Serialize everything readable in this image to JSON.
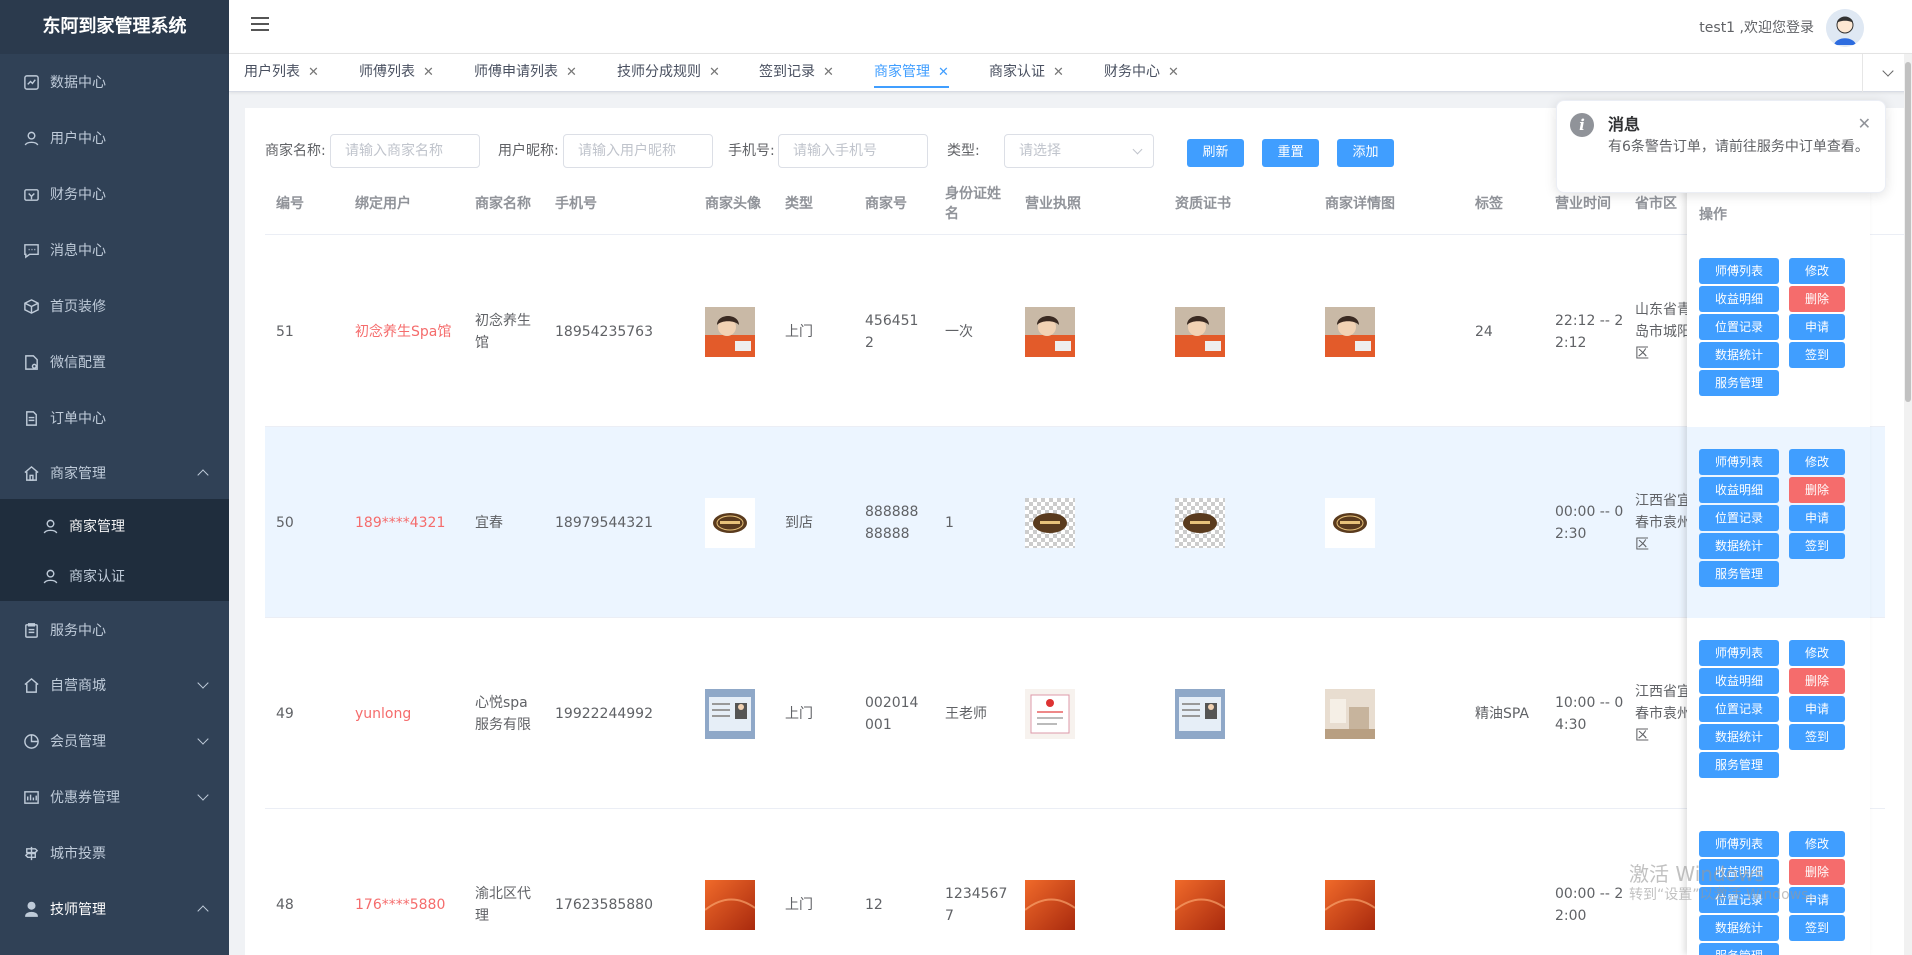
{
  "app_title": "东阿到家管理系统",
  "sidebar": {
    "items": [
      {
        "label": "数据中心",
        "icon": "chart-icon"
      },
      {
        "label": "用户中心",
        "icon": "user-icon"
      },
      {
        "label": "财务中心",
        "icon": "wallet-icon"
      },
      {
        "label": "消息中心",
        "icon": "message-icon"
      },
      {
        "label": "首页装修",
        "icon": "box-icon"
      },
      {
        "label": "微信配置",
        "icon": "config-icon"
      },
      {
        "label": "订单中心",
        "icon": "document-icon"
      },
      {
        "label": "商家管理",
        "icon": "shop-icon",
        "expanded": true
      },
      {
        "label": "服务中心",
        "icon": "clipboard-icon"
      },
      {
        "label": "自营商城",
        "icon": "home-icon"
      },
      {
        "label": "会员管理",
        "icon": "pie-icon"
      },
      {
        "label": "优惠券管理",
        "icon": "coupon-icon"
      },
      {
        "label": "城市投票",
        "icon": "signpost-icon"
      },
      {
        "label": "技师管理",
        "icon": "person-icon"
      }
    ],
    "sub_items": [
      {
        "label": "商家管理"
      },
      {
        "label": "商家认证"
      }
    ]
  },
  "header": {
    "user_text": "test1 ,欢迎您登录"
  },
  "tabs": [
    {
      "label": "用户列表"
    },
    {
      "label": "师傅列表"
    },
    {
      "label": "师傅申请列表"
    },
    {
      "label": "技师分成规则"
    },
    {
      "label": "签到记录"
    },
    {
      "label": "商家管理",
      "active": true
    },
    {
      "label": "商家认证"
    },
    {
      "label": "财务中心"
    }
  ],
  "search": {
    "name_label": "商家名称:",
    "name_placeholder": "请输入商家名称",
    "nick_label": "用户昵称:",
    "nick_placeholder": "请输入用户昵称",
    "phone_label": "手机号:",
    "phone_placeholder": "请输入手机号",
    "type_label": "类型:",
    "type_placeholder": "请选择",
    "refresh": "刷新",
    "reset": "重置",
    "add": "添加"
  },
  "table": {
    "columns": [
      "编号",
      "绑定用户",
      "商家名称",
      "手机号",
      "商家头像",
      "类型",
      "商家号",
      "身份证姓名",
      "营业执照",
      "资质证书",
      "商家详情图",
      "标签",
      "营业时间",
      "省市区"
    ],
    "ops_header": "操作",
    "rows": [
      {
        "id": "51",
        "user": "初念养生Spa馆",
        "name": "初念养生馆",
        "phone": "18954235763",
        "type": "上门",
        "no": "4564512",
        "idname": "一次",
        "tag": "24",
        "time": "22:12 -- 22:12",
        "region": "山东省青岛市城阳区",
        "img": "portrait"
      },
      {
        "id": "50",
        "user": "189****4321",
        "name": "宜春",
        "phone": "18979544321",
        "type": "到店",
        "no": "88888888888",
        "idname": "1",
        "tag": "",
        "time": "00:00 -- 02:30",
        "region": "江西省宜春市袁州区",
        "img": "logo"
      },
      {
        "id": "49",
        "user": "yunlong",
        "name": "心悦spa服务有限",
        "phone": "19922244992",
        "type": "上门",
        "no": "002014001",
        "idname": "王老师",
        "tag": "精油SPA",
        "time": "10:00 -- 04:30",
        "region": "江西省宜春市袁州区",
        "img": "idcard"
      },
      {
        "id": "48",
        "user": "176****5880",
        "name": "渝北区代理",
        "phone": "17623585880",
        "type": "上门",
        "no": "12",
        "idname": "12345677",
        "tag": "",
        "time": "00:00 -- 22:00",
        "region": "",
        "img": "orange"
      }
    ],
    "actions": {
      "masters": "师傅列表",
      "edit": "修改",
      "income": "收益明细",
      "delete": "删除",
      "location": "位置记录",
      "apply": "申请",
      "stats": "数据统计",
      "checkin": "签到",
      "service": "服务管理"
    }
  },
  "notification": {
    "title": "消息",
    "body": "有6条警告订单，请前往服务中订单查看。"
  },
  "watermark": {
    "line1": "激活 Windows",
    "line2": "转到“设置”以激活 Windows。"
  },
  "colors": {
    "sidebar": "#304156",
    "primary": "#409eff",
    "danger": "#f56c6c"
  }
}
